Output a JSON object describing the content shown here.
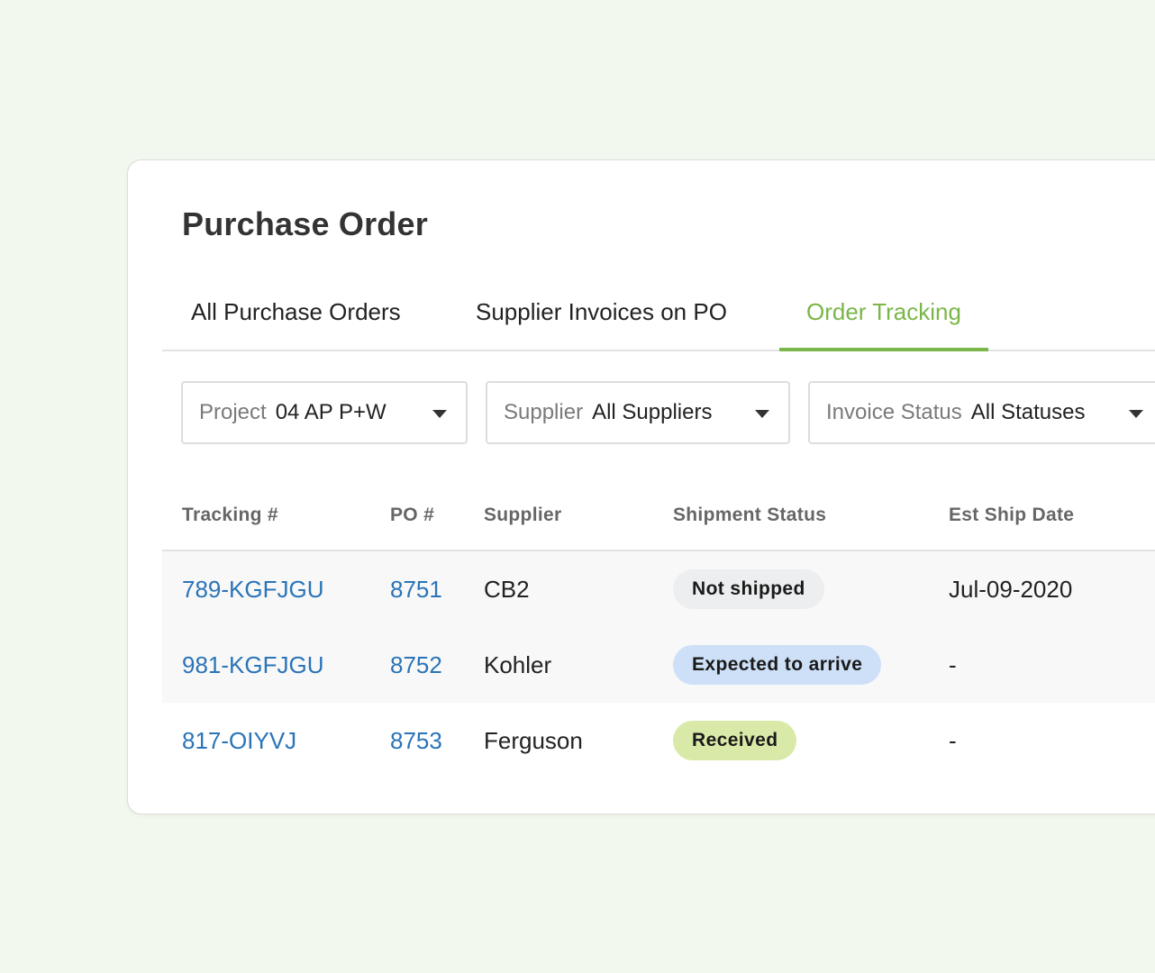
{
  "header": {
    "title": "Purchase Order"
  },
  "tabs": [
    {
      "label": "All Purchase Orders",
      "active": false
    },
    {
      "label": "Supplier Invoices on PO",
      "active": false
    },
    {
      "label": "Order Tracking",
      "active": true
    }
  ],
  "filters": [
    {
      "label": "Project",
      "value": "04 AP P+W",
      "icon": "caret-down-icon"
    },
    {
      "label": "Supplier",
      "value": "All Suppliers",
      "icon": "caret-down-icon"
    },
    {
      "label": "Invoice Status",
      "value": "All Statuses",
      "icon": "caret-down-icon"
    }
  ],
  "table": {
    "columns": [
      "Tracking #",
      "PO #",
      "Supplier",
      "Shipment Status",
      "Est Ship Date"
    ],
    "rows": [
      {
        "tracking": "789-KGFJGU",
        "po": "8751",
        "supplier": "CB2",
        "status": "Not shipped",
        "status_color": "#eceef0",
        "est_ship_date": "Jul-09-2020"
      },
      {
        "tracking": "981-KGFJGU",
        "po": "8752",
        "supplier": "Kohler",
        "status": "Expected to arrive",
        "status_color": "#cde0f7",
        "est_ship_date": "-"
      },
      {
        "tracking": "817-OIYVJ",
        "po": "8753",
        "supplier": "Ferguson",
        "status": "Received",
        "status_color": "#d9eaa8",
        "est_ship_date": "-"
      }
    ]
  },
  "colors": {
    "accent": "#7ab648",
    "link": "#2a74b8",
    "background": "#f2f8ee"
  }
}
